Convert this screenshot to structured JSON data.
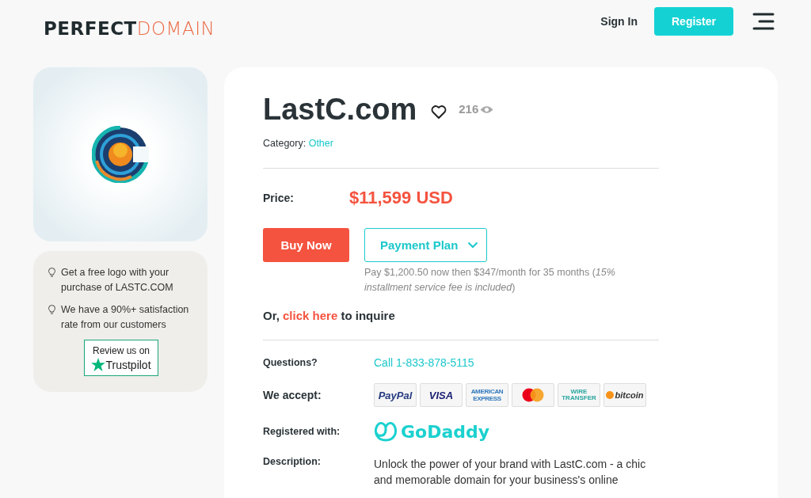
{
  "header": {
    "logo": {
      "part_1": "PERFECT",
      "part_2": "DOMAIN"
    },
    "sign_in": "Sign In",
    "register": "Register"
  },
  "sidebar": {
    "perks": [
      "Get a free logo with your purchase of LASTC.COM",
      "We have a 90%+ satisfaction rate from our customers"
    ],
    "review": {
      "line_1": "Review us on",
      "line_2": "Trustpilot"
    }
  },
  "domain": {
    "name": "LastC.com",
    "favorited": false,
    "views": "216",
    "category_label": "Category:",
    "category": "Other"
  },
  "price": {
    "label": "Price:",
    "value": "$11,599 USD"
  },
  "buy_button": "Buy Now",
  "payment_plan": {
    "label": "Payment Plan",
    "expanded": false,
    "note": "Pay $1,200.50 now then $347/month for 35 months (*15% installment service fee is included*)"
  },
  "inquire": {
    "before": "Or,",
    "link": "click here",
    "after": "to inquire"
  },
  "details": [
    {
      "kind": "phone",
      "label": "Questions?",
      "value": "Call 1-833-878-5115"
    },
    {
      "kind": "payments",
      "label": "We accept:",
      "logos": [
        {
          "kind": "paypal",
          "lines": [
            "PayPal"
          ]
        },
        {
          "kind": "visa",
          "lines": [
            "VISA"
          ]
        },
        {
          "kind": "amex",
          "lines": [
            "AMERICAN",
            "EXPRESS"
          ]
        },
        {
          "kind": "mastercard"
        },
        {
          "kind": "wire",
          "lines": [
            "WIRE",
            "TRANSFER"
          ]
        },
        {
          "kind": "bitcoin",
          "lines": [
            "bitcoin"
          ]
        }
      ]
    },
    {
      "kind": "registrar",
      "label": "Registered with:",
      "value": "GoDaddy"
    },
    {
      "kind": "text",
      "label": "Description:",
      "value": "Unlock the power of your brand with LastC.com - a chic and memorable domain for your business's online"
    }
  ]
}
